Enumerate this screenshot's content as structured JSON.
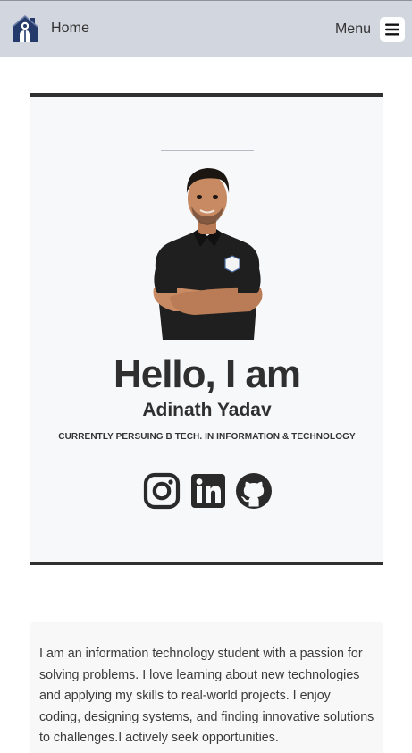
{
  "nav": {
    "home_label": "Home",
    "menu_label": "Menu",
    "home_icon": "house-icon",
    "menu_icon": "hamburger-menu-icon"
  },
  "hero": {
    "greeting": "Hello, I am",
    "name": "Adinath Yadav",
    "tagline": "CURRENTLY PERSUING B TECH. IN INFORMATION & TECHNOLOGY",
    "social_icons": [
      "instagram-icon",
      "linkedin-icon",
      "github-icon"
    ]
  },
  "about": {
    "text": "I am an information technology student with a passion for solving problems. I love learning about new technologies and applying my skills to real-world projects. I enjoy coding, designing systems, and finding innovative solutions to challenges.I actively seek opportunities."
  },
  "colors": {
    "nav_background": "#d2d6de",
    "hero_background": "#f7f8fa",
    "hero_border": "#303030",
    "text": "#2f2f2f",
    "house_icon": "#243a6b"
  }
}
